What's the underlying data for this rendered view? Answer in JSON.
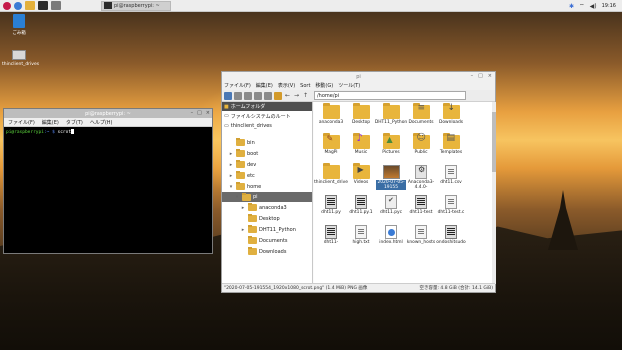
{
  "taskbar": {
    "task_label": "pi@raspberrypi: ~",
    "clock": "19:16"
  },
  "desktop": {
    "icons": [
      {
        "label": "ごみ箱"
      },
      {
        "label": "thinclient_drives"
      }
    ]
  },
  "terminal": {
    "title": "pi@raspberrypi: ~",
    "menu": [
      "ファイル(F)",
      "編集(E)",
      "タブ(T)",
      "ヘルプ(H)"
    ],
    "prompt_user": "pi@raspberrypi",
    "prompt_path": ":~ $",
    "command": "scrot"
  },
  "filemanager": {
    "title": "pi",
    "menu": [
      "ファイル(F)",
      "編集(E)",
      "表示(V)",
      "Sort",
      "移動(G)",
      "ツール(T)"
    ],
    "address": "/home/pi",
    "places": [
      {
        "label": "ホームフォルダ"
      },
      {
        "label": "ファイルシステムのルート"
      },
      {
        "label": "thinclient_drives"
      }
    ],
    "tree": [
      {
        "label": "bin"
      },
      {
        "label": "boot"
      },
      {
        "label": "dev"
      },
      {
        "label": "etc"
      },
      {
        "label": "home"
      },
      {
        "label": "pi"
      },
      {
        "label": "anaconda3"
      },
      {
        "label": "Desktop"
      },
      {
        "label": "DHT11_Python"
      },
      {
        "label": "Documents"
      },
      {
        "label": "Downloads"
      }
    ],
    "files": [
      {
        "label": "anaconda3",
        "icon": "folder"
      },
      {
        "label": "Desktop",
        "icon": "folder"
      },
      {
        "label": "DHT11_Python",
        "icon": "folder"
      },
      {
        "label": "Documents",
        "icon": "folder docs"
      },
      {
        "label": "Downloads",
        "icon": "folder dl"
      },
      {
        "label": "",
        "icon": "none"
      },
      {
        "label": "MagPi",
        "icon": "folder mag"
      },
      {
        "label": "Music",
        "icon": "folder music"
      },
      {
        "label": "Pictures",
        "icon": "folder pic"
      },
      {
        "label": "Public",
        "icon": "folder pub"
      },
      {
        "label": "Templates",
        "icon": "folder tpl"
      },
      {
        "label": "",
        "icon": "none"
      },
      {
        "label": "thinclient_drives",
        "icon": "folder"
      },
      {
        "label": "Videos",
        "icon": "folder vid"
      },
      {
        "label": "2020-07-05-191554_1920x1080_scrot.png",
        "icon": "img",
        "selected": true
      },
      {
        "label": "Anaconda3-4.4.0-Linux-x86_64.sh",
        "icon": "gear"
      },
      {
        "label": "dht11.csv",
        "icon": "doc"
      },
      {
        "label": "",
        "icon": "none"
      },
      {
        "label": "dht11.py",
        "icon": "script"
      },
      {
        "label": "dht11.py.1",
        "icon": "script"
      },
      {
        "label": "dht11.pyc",
        "icon": "check"
      },
      {
        "label": "dht11-test",
        "icon": "script"
      },
      {
        "label": "dht11-test.c",
        "icon": "doc"
      },
      {
        "label": "",
        "icon": "none"
      },
      {
        "label": "dht11-",
        "icon": "script"
      },
      {
        "label": "high.txt",
        "icon": "doc"
      },
      {
        "label": "index.html",
        "icon": "html"
      },
      {
        "label": "known_hosts",
        "icon": "doc"
      },
      {
        "label": "ondoshitsudo",
        "icon": "script"
      }
    ],
    "status_left": "\"2020-07-05-191554_1920x1080_scrot.png\" (1.4 MiB) PNG 画像",
    "status_right": "空き容量: 4.8 GiB (合計: 14.1 GiB)"
  }
}
